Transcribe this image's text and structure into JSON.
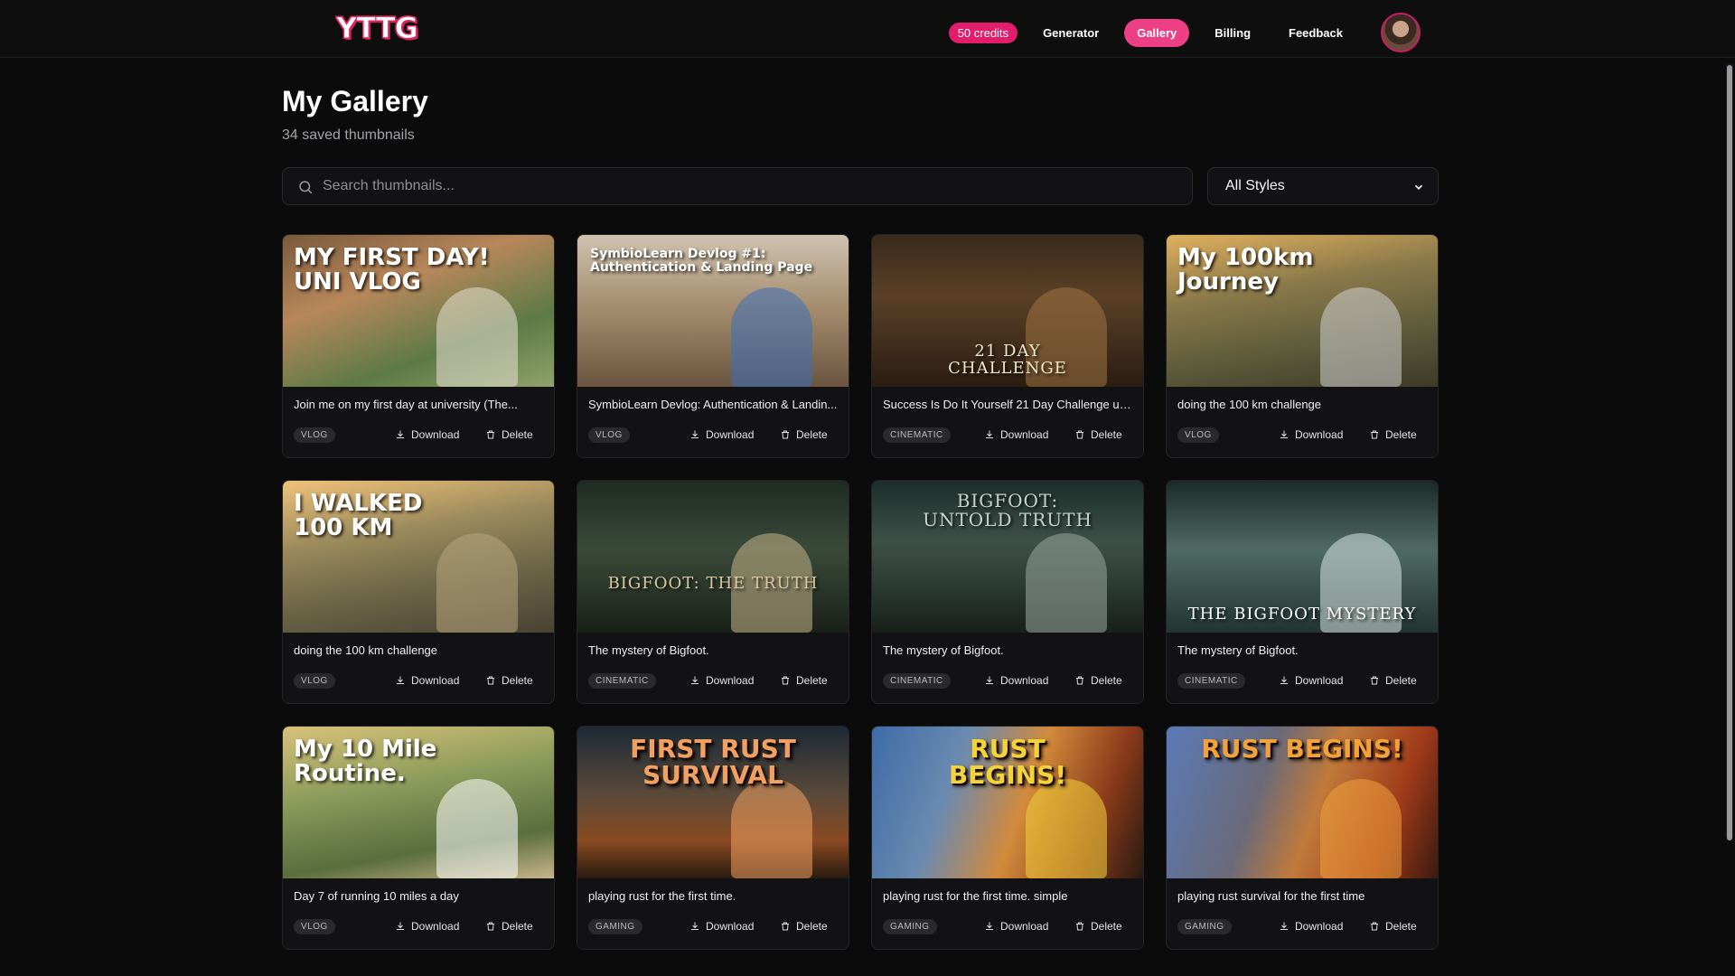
{
  "header": {
    "logo": "YTTG",
    "credits": "50 credits",
    "nav": [
      "Generator",
      "Gallery",
      "Billing",
      "Feedback"
    ],
    "active_nav": "Gallery"
  },
  "page": {
    "title": "My Gallery",
    "subtitle": "34 saved thumbnails",
    "search_placeholder": "Search thumbnails...",
    "style_filter": "All Styles"
  },
  "labels": {
    "download": "Download",
    "delete": "Delete"
  },
  "cards": [
    {
      "overlay": "MY FIRST DAY!\nUNI VLOG",
      "desc": "Join me on my first day at university (The...",
      "style": "VLOG",
      "bg": "linear-gradient(160deg,#7a5a3c 0%,#b7875a 35%,#5d7a46 70%,#8fa36a 100%)",
      "accent": "#e8e0d4"
    },
    {
      "overlay": "SymbioLearn Devlog #1:\nAuthentication & Landing Page",
      "desc": "SymbioLearn Devlog: Authentication & Landin...",
      "style": "VLOG",
      "bg": "linear-gradient(180deg,#cfc3b0 0%,#a28a6b 50%,#6b5540 100%)",
      "accent": "#3c6fb8"
    },
    {
      "overlay": "21 DAY\nCHALLENGE",
      "desc": "Success Is Do It Yourself 21 Day Challenge us...",
      "style": "CINEMATIC",
      "bg": "linear-gradient(180deg,#3a2a1c 0%,#5b4026 40%,#2a1d12 100%)",
      "accent": "#a07444"
    },
    {
      "overlay": "My 100km\nJourney",
      "desc": "doing the 100 km challenge",
      "style": "VLOG",
      "bg": "linear-gradient(170deg,#e0b05e 0%,#8c7a4a 35%,#5b5a3a 70%,#3d3a28 100%)",
      "accent": "#cfcfcf"
    },
    {
      "overlay": "I WALKED\n100 KM",
      "desc": "doing the 100 km challenge",
      "style": "VLOG",
      "bg": "linear-gradient(170deg,#f0c27a 0%,#9b8a5c 35%,#6d6648 65%,#4a4232 100%)",
      "accent": "#b6a57e"
    },
    {
      "overlay": "BIGFOOT: THE TRUTH",
      "desc": "The mystery of Bigfoot.",
      "style": "CINEMATIC",
      "bg": "linear-gradient(180deg,#1e2a22 0%,#3a4a3a 45%,#1a2118 100%)",
      "accent": "#c7b48a"
    },
    {
      "overlay": "BIGFOOT:\nUNTOLD TRUTH",
      "desc": "The mystery of Bigfoot.",
      "style": "CINEMATIC",
      "bg": "linear-gradient(180deg,#1d2e2a 0%,#3d5048 40%,#2a3a30 70%,#18201a 100%)",
      "accent": "#9aa8a0"
    },
    {
      "overlay": "THE BIGFOOT MYSTERY",
      "desc": "The mystery of Bigfoot.",
      "style": "CINEMATIC",
      "bg": "linear-gradient(180deg,#1a2a26 0%,#4f6a64 45%,#223530 100%)",
      "accent": "#d8e6e2"
    },
    {
      "overlay": "My 10 Mile\nRoutine.",
      "desc": "Day 7 of running 10 miles a day",
      "style": "VLOG",
      "bg": "linear-gradient(170deg,#d8c27a 0%,#8a9a5a 40%,#5a6e3e 75%,#c8b48a 100%)",
      "accent": "#ffffff"
    },
    {
      "overlay": "FIRST RUST\nSURVIVAL",
      "desc": "playing rust for the first time.",
      "style": "GAMING",
      "bg": "linear-gradient(180deg,#1d2a36 0%,#5a4a3a 45%,#8a4a22 75%,#2a1a10 100%)",
      "accent": "#f0a060"
    },
    {
      "overlay": "RUST\nBEGINS!",
      "desc": "playing rust for the first time. simple",
      "style": "GAMING",
      "bg": "linear-gradient(110deg,#3e6ca8 0%,#6a8ab0 30%,#d28a3a 55%,#8a3a1a 80%,#2a1a12 100%)",
      "accent": "#f2d33a"
    },
    {
      "overlay": "RUST BEGINS!",
      "desc": "playing rust survival for the first time",
      "style": "GAMING",
      "bg": "linear-gradient(110deg,#5a7ab8 0%,#6a6a7a 35%,#c07a3a 55%,#a03a1a 80%,#3a1a10 100%)",
      "accent": "#f2a23a"
    }
  ]
}
